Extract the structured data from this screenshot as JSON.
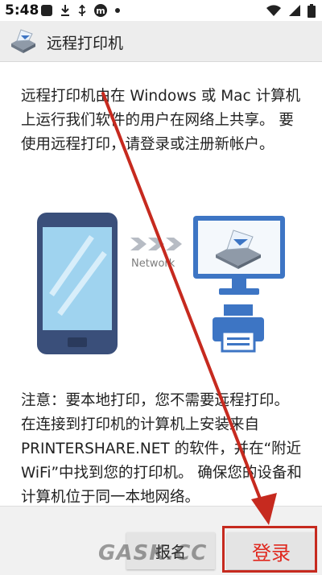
{
  "status_bar": {
    "time": "5:48",
    "left_icons": [
      "square-icon",
      "download-icon",
      "usb-icon",
      "m-app-icon",
      "dot-icon"
    ],
    "right_icons": [
      "wifi-icon",
      "signal-icon",
      "battery-icon"
    ]
  },
  "app_bar": {
    "title": "远程打印机",
    "icon": "printer-app-icon"
  },
  "content": {
    "description": "远程打印机由在 Windows 或 Mac 计算机上运行我们软件的用户在网络上共享。 要使用远程打印，请登录或注册新帐户。",
    "illustration": {
      "network_label": "Network",
      "icons": [
        "phone-icon",
        "network-arrows-icon",
        "monitor-icon",
        "printer-icon"
      ]
    },
    "note": "注意：要本地打印，您不需要远程打印。 在连接到打印机的计算机上安装来自 PRINTERSHARE.NET 的软件，并在“附近 WiFi”中找到您的打印机。 确保您的设备和计算机位于同一本地网络。"
  },
  "buttons": {
    "register": "报名",
    "login": "登录"
  },
  "colors": {
    "annotation_red": "#c62a1f",
    "illustration_blue": "#3d75c4",
    "phone_frame": "#3a4f7a",
    "app_bar_bg": "#ededed"
  },
  "watermark": "GASK.CC"
}
